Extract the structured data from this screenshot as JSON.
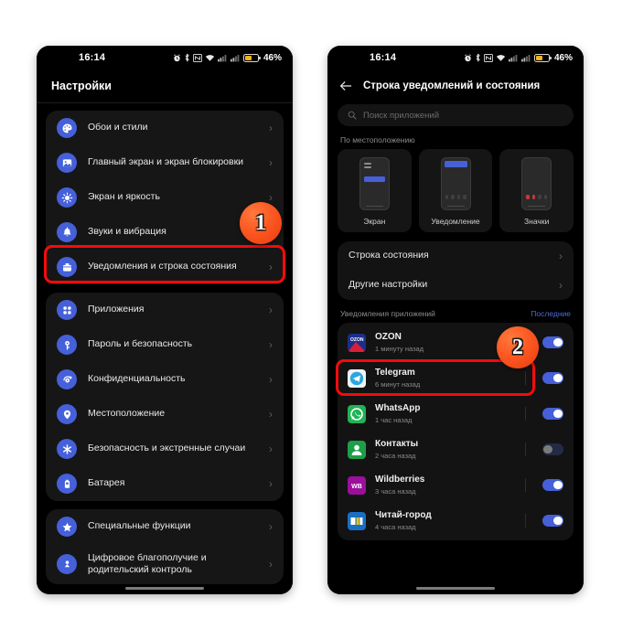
{
  "status_bar": {
    "time": "16:14",
    "battery_percent": "46%",
    "icons": [
      "alarm-icon",
      "bluetooth-icon",
      "nfc-icon",
      "wifi-icon",
      "signal-sim1-icon",
      "signal-sim2-icon",
      "battery-icon"
    ]
  },
  "left_phone": {
    "title": "Настройки",
    "groups": [
      {
        "items": [
          {
            "label": "Обои и стили",
            "icon": "palette-icon",
            "icon_color": "#4560d8",
            "highlighted": false
          },
          {
            "label": "Главный экран и экран блокировки",
            "icon": "image-icon",
            "icon_color": "#4560d8",
            "highlighted": false
          },
          {
            "label": "Экран и яркость",
            "icon": "brightness-icon",
            "icon_color": "#4560d8",
            "highlighted": false
          },
          {
            "label": "Звуки и вибрация",
            "icon": "bell-icon",
            "icon_color": "#4560d8",
            "highlighted": false
          },
          {
            "label": "Уведомления и строка состояния",
            "icon": "notification-box-icon",
            "icon_color": "#4560d8",
            "highlighted": true
          }
        ]
      },
      {
        "items": [
          {
            "label": "Приложения",
            "icon": "apps-grid-icon",
            "icon_color": "#4560d8",
            "highlighted": false
          },
          {
            "label": "Пароль и безопасность",
            "icon": "key-icon",
            "icon_color": "#4560d8",
            "highlighted": false
          },
          {
            "label": "Конфиденциальность",
            "icon": "privacy-hand-icon",
            "icon_color": "#4560d8",
            "highlighted": false
          },
          {
            "label": "Местоположение",
            "icon": "location-pin-icon",
            "icon_color": "#4560d8",
            "highlighted": false
          },
          {
            "label": "Безопасность и экстренные случаи",
            "icon": "emergency-star-icon",
            "icon_color": "#4560d8",
            "highlighted": false
          },
          {
            "label": "Батарея",
            "icon": "battery-settings-icon",
            "icon_color": "#4560d8",
            "highlighted": false
          }
        ]
      },
      {
        "items": [
          {
            "label": "Специальные функции",
            "icon": "star-icon",
            "icon_color": "#4560d8",
            "highlighted": false
          },
          {
            "label": "Цифровое благополучие и родительский контроль",
            "icon": "wellbeing-icon",
            "icon_color": "#4560d8",
            "highlighted": false
          }
        ]
      }
    ]
  },
  "right_phone": {
    "title": "Строка уведомлений и состояния",
    "back_icon": "back-arrow-icon",
    "search": {
      "placeholder": "Поиск приложений",
      "icon": "search-icon"
    },
    "location_section": {
      "caption": "По местоположению",
      "tiles": [
        {
          "label": "Экран",
          "preview": "screen-preview"
        },
        {
          "label": "Уведомление",
          "preview": "notification-preview"
        },
        {
          "label": "Значки",
          "preview": "badges-preview"
        }
      ]
    },
    "settings_rows": [
      {
        "label": "Строка состояния"
      },
      {
        "label": "Другие настройки"
      }
    ],
    "apps_section": {
      "caption": "Уведомления приложений",
      "link": "Последние"
    },
    "apps": [
      {
        "name": "OZON",
        "time": "1 минуту назад",
        "toggle": "on",
        "icon": "ozon-icon",
        "icon_bg": "#1b2e8c",
        "highlighted": true
      },
      {
        "name": "Telegram",
        "time": "6 минут назад",
        "toggle": "on",
        "icon": "telegram-icon",
        "icon_bg": "#e7eef5",
        "highlighted": false
      },
      {
        "name": "WhatsApp",
        "time": "1 час назад",
        "toggle": "on",
        "icon": "whatsapp-icon",
        "icon_bg": "#1fb355",
        "highlighted": false
      },
      {
        "name": "Контакты",
        "time": "2 часа назад",
        "toggle": "off",
        "icon": "contacts-icon",
        "icon_bg": "#1d9f4a",
        "highlighted": false
      },
      {
        "name": "Wildberries",
        "time": "3 часа назад",
        "toggle": "on",
        "icon": "wildberries-icon",
        "icon_bg": "#9c0f9c",
        "highlighted": false
      },
      {
        "name": "Читай-город",
        "time": "4 часа назад",
        "toggle": "on",
        "icon": "chitaigorod-icon",
        "icon_bg": "#1a6fc4",
        "highlighted": false
      }
    ]
  },
  "step_badges": [
    {
      "number": "1",
      "color": "#fc5a23"
    },
    {
      "number": "2",
      "color": "#fc5a23"
    }
  ]
}
